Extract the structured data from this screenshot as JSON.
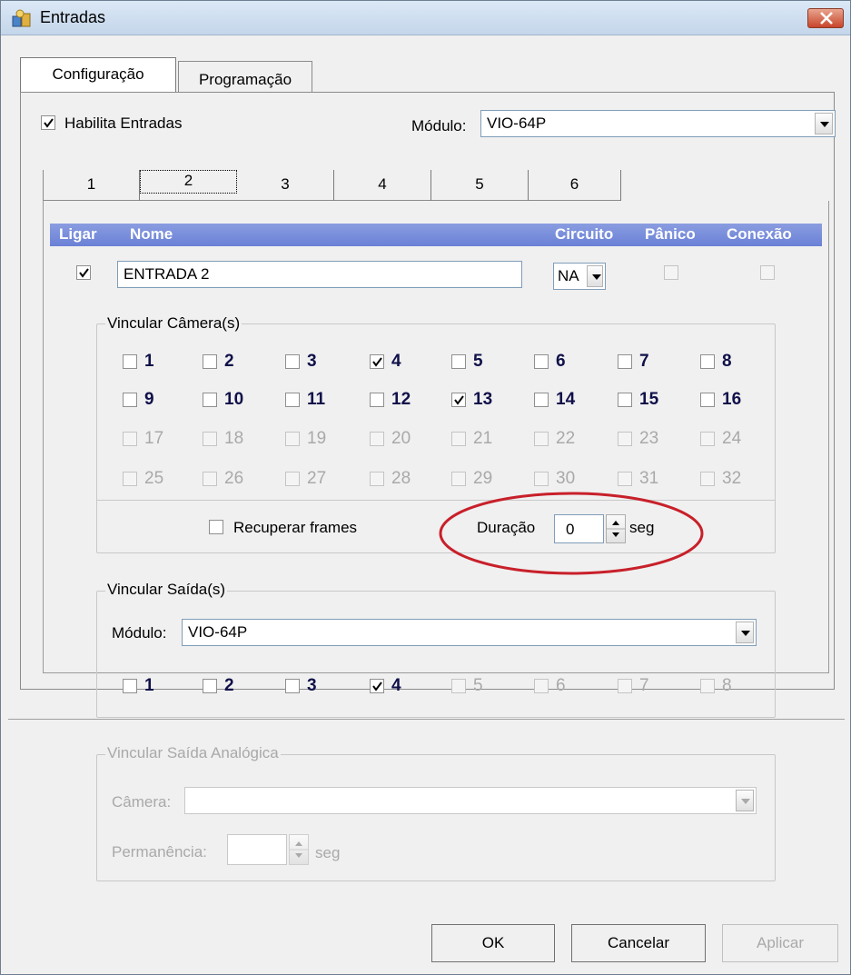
{
  "window": {
    "title": "Entradas"
  },
  "tabs": [
    {
      "label": "Configuração",
      "active": true
    },
    {
      "label": "Programação",
      "active": false
    }
  ],
  "habilita": {
    "label": "Habilita Entradas",
    "checked": true
  },
  "modulo": {
    "label": "Módulo:",
    "value": "VIO-64P"
  },
  "input_tabs": [
    "1",
    "2",
    "3",
    "4",
    "5",
    "6"
  ],
  "active_input_tab": "2",
  "header": {
    "ligar": "Ligar",
    "nome": "Nome",
    "circuito": "Circuito",
    "panico": "Pânico",
    "conexao": "Conexão"
  },
  "entry": {
    "ligar_checked": true,
    "name": "ENTRADA 2",
    "circuito": "NA",
    "panico": false,
    "conexao": false
  },
  "cameras": {
    "title": "Vincular Câmera(s)",
    "rows": [
      [
        "1",
        "2",
        "3",
        "4",
        "5",
        "6",
        "7",
        "8"
      ],
      [
        "9",
        "10",
        "11",
        "12",
        "13",
        "14",
        "15",
        "16"
      ],
      [
        "17",
        "18",
        "19",
        "20",
        "21",
        "22",
        "23",
        "24"
      ],
      [
        "25",
        "26",
        "27",
        "28",
        "29",
        "30",
        "31",
        "32"
      ]
    ],
    "checked": [
      "4",
      "13"
    ],
    "enabled_rows": 2,
    "recuperar": "Recuperar frames",
    "duracao_label": "Duração",
    "duracao_value": "0",
    "seg": "seg"
  },
  "saidas": {
    "title": "Vincular Saída(s)",
    "modulo_label": "Módulo:",
    "modulo_value": "VIO-64P",
    "items": [
      "1",
      "2",
      "3",
      "4",
      "5",
      "6",
      "7",
      "8"
    ],
    "checked": [
      "4"
    ],
    "enabled_count": 4
  },
  "analogica": {
    "title": "Vincular Saída Analógica",
    "camera_label": "Câmera:",
    "camera_value": "",
    "permanencia_label": "Permanência:",
    "permanencia_value": "",
    "seg": "seg"
  },
  "buttons": {
    "ok": "OK",
    "cancelar": "Cancelar",
    "aplicar": "Aplicar"
  },
  "colors": {
    "header_bar": "#7b8fdc",
    "highlight_ellipse": "#c8202a",
    "check_label": "#10104a"
  }
}
